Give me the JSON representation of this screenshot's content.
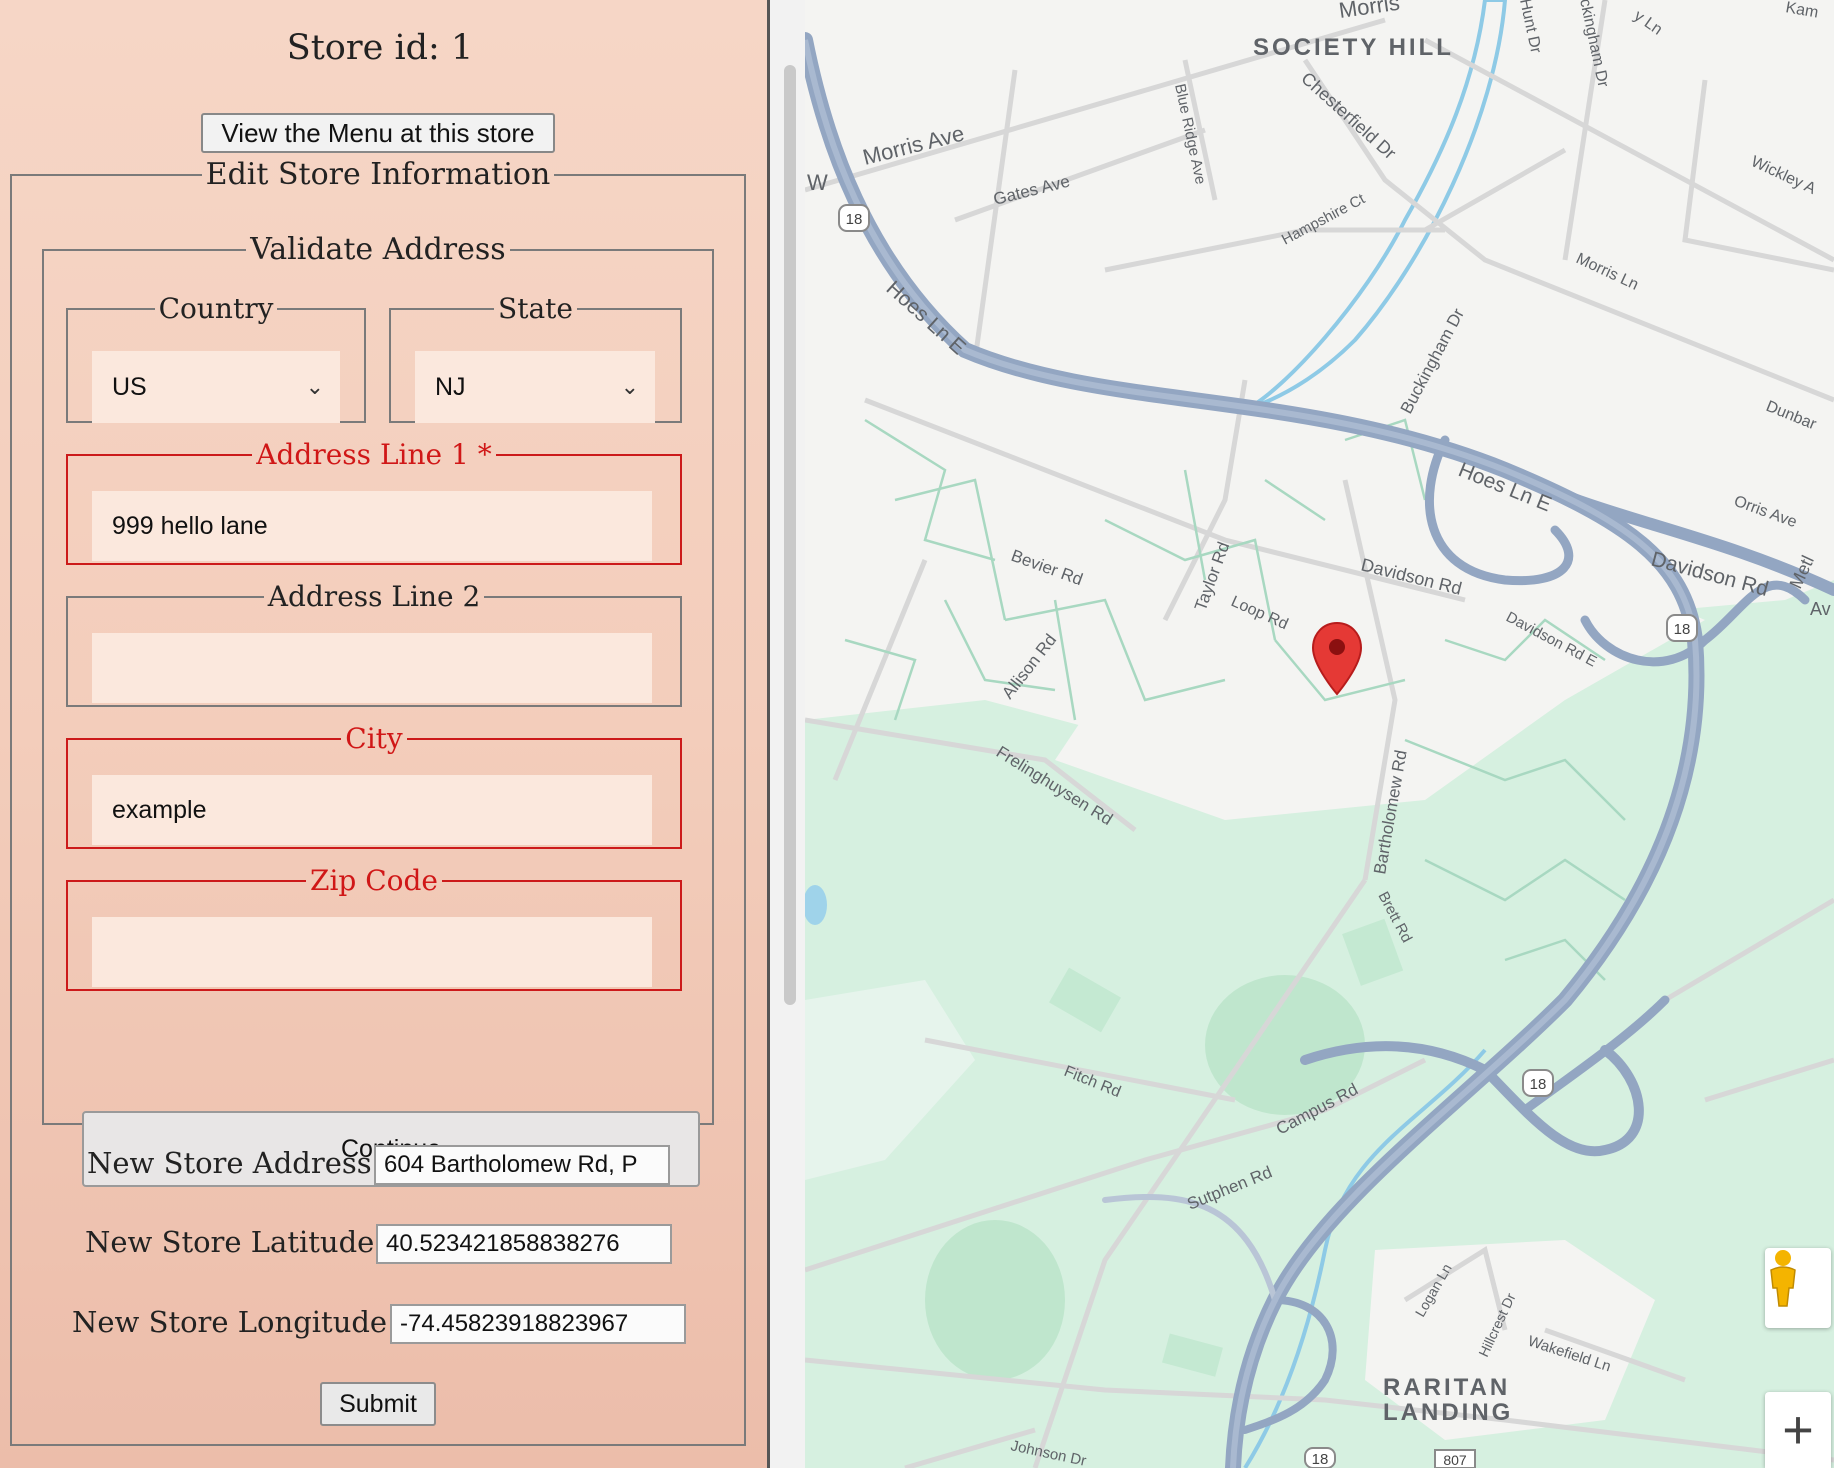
{
  "form": {
    "store_title": "Store id: 1",
    "view_menu_button": "View the Menu at this store",
    "edit_legend": "Edit Store Information",
    "validate_legend": "Validate Address",
    "country": {
      "label": "Country",
      "value": "US"
    },
    "state": {
      "label": "State",
      "value": "NJ"
    },
    "address1": {
      "label": "Address Line 1 *",
      "value": "999 hello lane"
    },
    "address2": {
      "label": "Address Line 2",
      "value": ""
    },
    "city": {
      "label": "City",
      "value": "example"
    },
    "zip": {
      "label": "Zip Code",
      "value": ""
    },
    "continue_button": "Continue",
    "new_address": {
      "label": "New Store Address:",
      "value": "604 Bartholomew Rd, P"
    },
    "new_latitude": {
      "label": "New Store Latitude:",
      "value": "40.523421858838276"
    },
    "new_longitude": {
      "label": "New Store Longitude:",
      "value": "-74.45823918823967"
    },
    "submit_button": "Submit",
    "colors": {
      "required": "#cc1a1a",
      "panel_bg": "#f4d2c1"
    }
  },
  "map": {
    "labels": {
      "society_hill": "SOCIETY HILL",
      "raritan_landing": "RARITAN",
      "raritan_landing2": "LANDING",
      "morris_ave": "Morris Ave",
      "morris_top": "Morris",
      "w": "W",
      "gates_ave": "Gates Ave",
      "blue_ridge": "Blue Ridge Ave",
      "chesterfield": "Chesterfield Dr",
      "hampshire": "Hampshire Ct",
      "buckingham": "Buckingham Dr",
      "buckingham_top": "ckingham Dr",
      "hunt_dr": "Hunt Dr",
      "y_ln": "y Ln",
      "kam": "Kam",
      "wickley": "Wickley A",
      "morris_ln": "Morris Ln",
      "dunbar": "Dunbar",
      "orris_ave": "Orris Ave",
      "hoes_ln_e1": "Hoes Ln E",
      "hoes_ln_e2": "Hoes Ln E",
      "davidson_rd": "Davidson Rd",
      "davidson_rd2": "Davidson Rd",
      "davidson_rd_e": "Davidson Rd E",
      "metl": "Metl",
      "av": "Av",
      "bevier": "Bevier Rd",
      "taylor": "Taylor Rd",
      "loop": "Loop Rd",
      "allison": "Allison Rd",
      "frelinghuysen": "Frelinghuysen Rd",
      "bartholomew": "Bartholomew Rd",
      "brett": "Brett Rd",
      "fitch": "Fitch Rd",
      "campus": "Campus Rd",
      "sutphen": "Sutphen Rd",
      "logan": "Logan Ln",
      "hillcrest": "Hillcrest Dr",
      "wakefield": "Wakefield Ln",
      "johnson": "Johnson Dr",
      "shield_18": "18",
      "shield_807": "807"
    },
    "icons": {
      "marker": "map-pin-icon",
      "pegman": "street-view-pegman-icon",
      "zoom": "zoom-in-icon"
    },
    "colors": {
      "highway": "#8fa3c0",
      "park": "#cdeedb",
      "marker": "#e53935",
      "water": "#8ecae6"
    }
  }
}
